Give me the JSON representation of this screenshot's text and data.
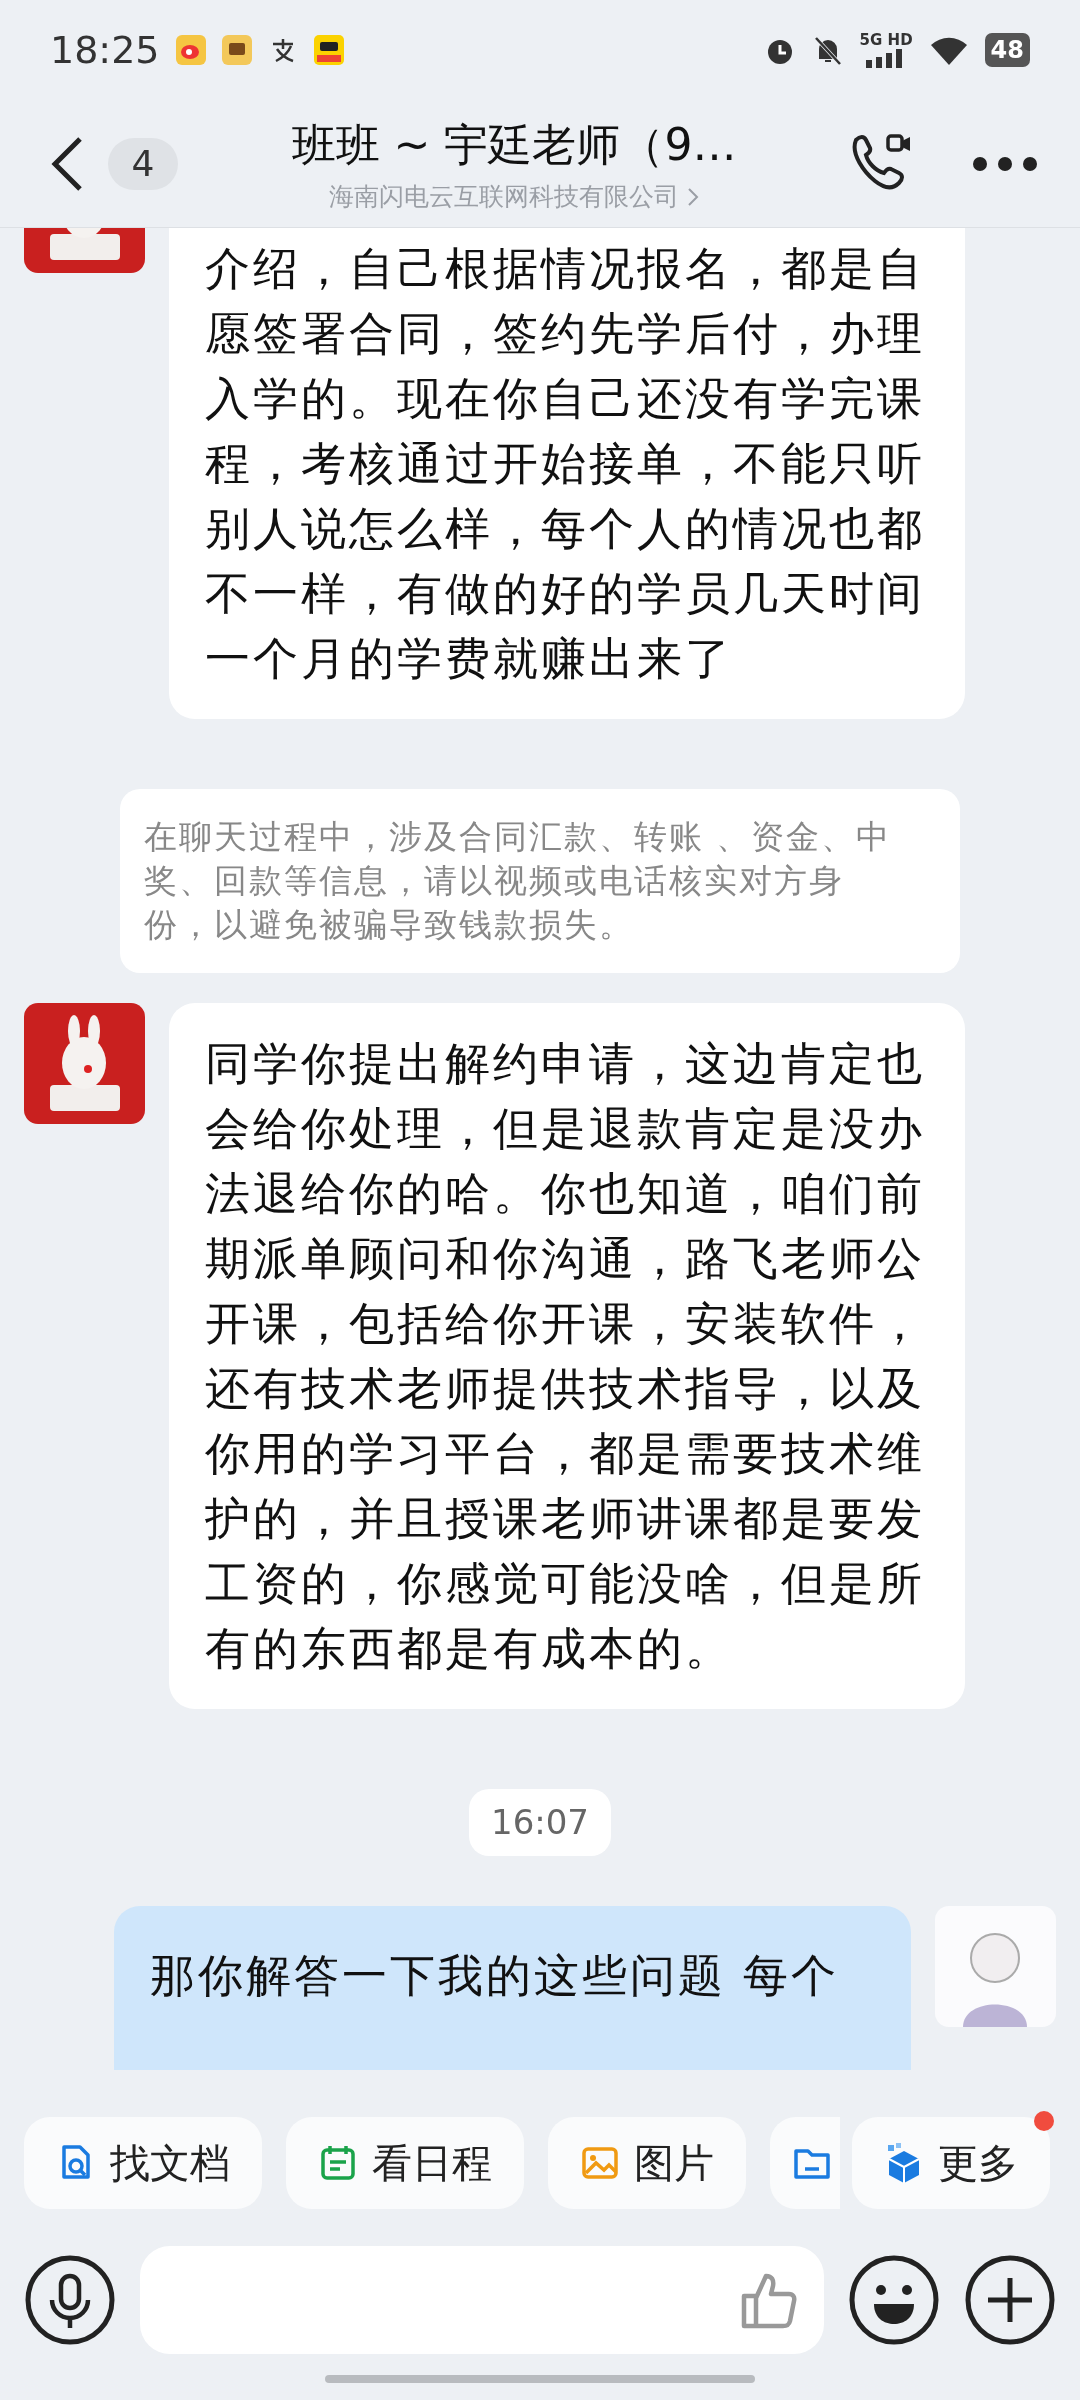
{
  "status_bar": {
    "time": "18:25",
    "network": "5G HD",
    "battery": "48"
  },
  "header": {
    "unread_count": "4",
    "title": "班班 ~ 宇廷老师（9…",
    "subtitle": "海南闪电云互联网科技有限公司"
  },
  "messages": [
    {
      "kind": "incoming",
      "text": "介绍，自己根据情况报名，都是自愿签署合同，签约先学后付，办理入学的。现在你自己还没有学完课程，考核通过开始接单，不能只听别人说怎么样，每个人的情况也都不一样，有做的好的学员几天时间一个月的学费就赚出来了"
    },
    {
      "kind": "notice",
      "text": "在聊天过程中，涉及合同汇款、转账 、资金、中奖、回款等信息，请以视频或电话核实对方身份，以避免被骗导致钱款损失。"
    },
    {
      "kind": "incoming",
      "text": "同学你提出解约申请，这边肯定也会给你处理，但是退款肯定是没办法退给你的哈。你也知道，咱们前期派单顾问和你沟通，路飞老师公开课，包括给你开课，安装软件，还有技术老师提供技术指导，以及你用的学习平台，都是需要技术维护的，并且授课老师讲课都是要发工资的，你感觉可能没啥，但是所有的东西都是有成本的。"
    },
    {
      "kind": "time",
      "text": "16:07"
    },
    {
      "kind": "outgoing",
      "text": "那你解答一下我的这些问题 每个"
    }
  ],
  "quick_actions": [
    {
      "label": "找文档"
    },
    {
      "label": "看日程"
    },
    {
      "label": "图片"
    },
    {
      "kind": "cut"
    },
    {
      "label": "更多",
      "badge": true
    }
  ]
}
